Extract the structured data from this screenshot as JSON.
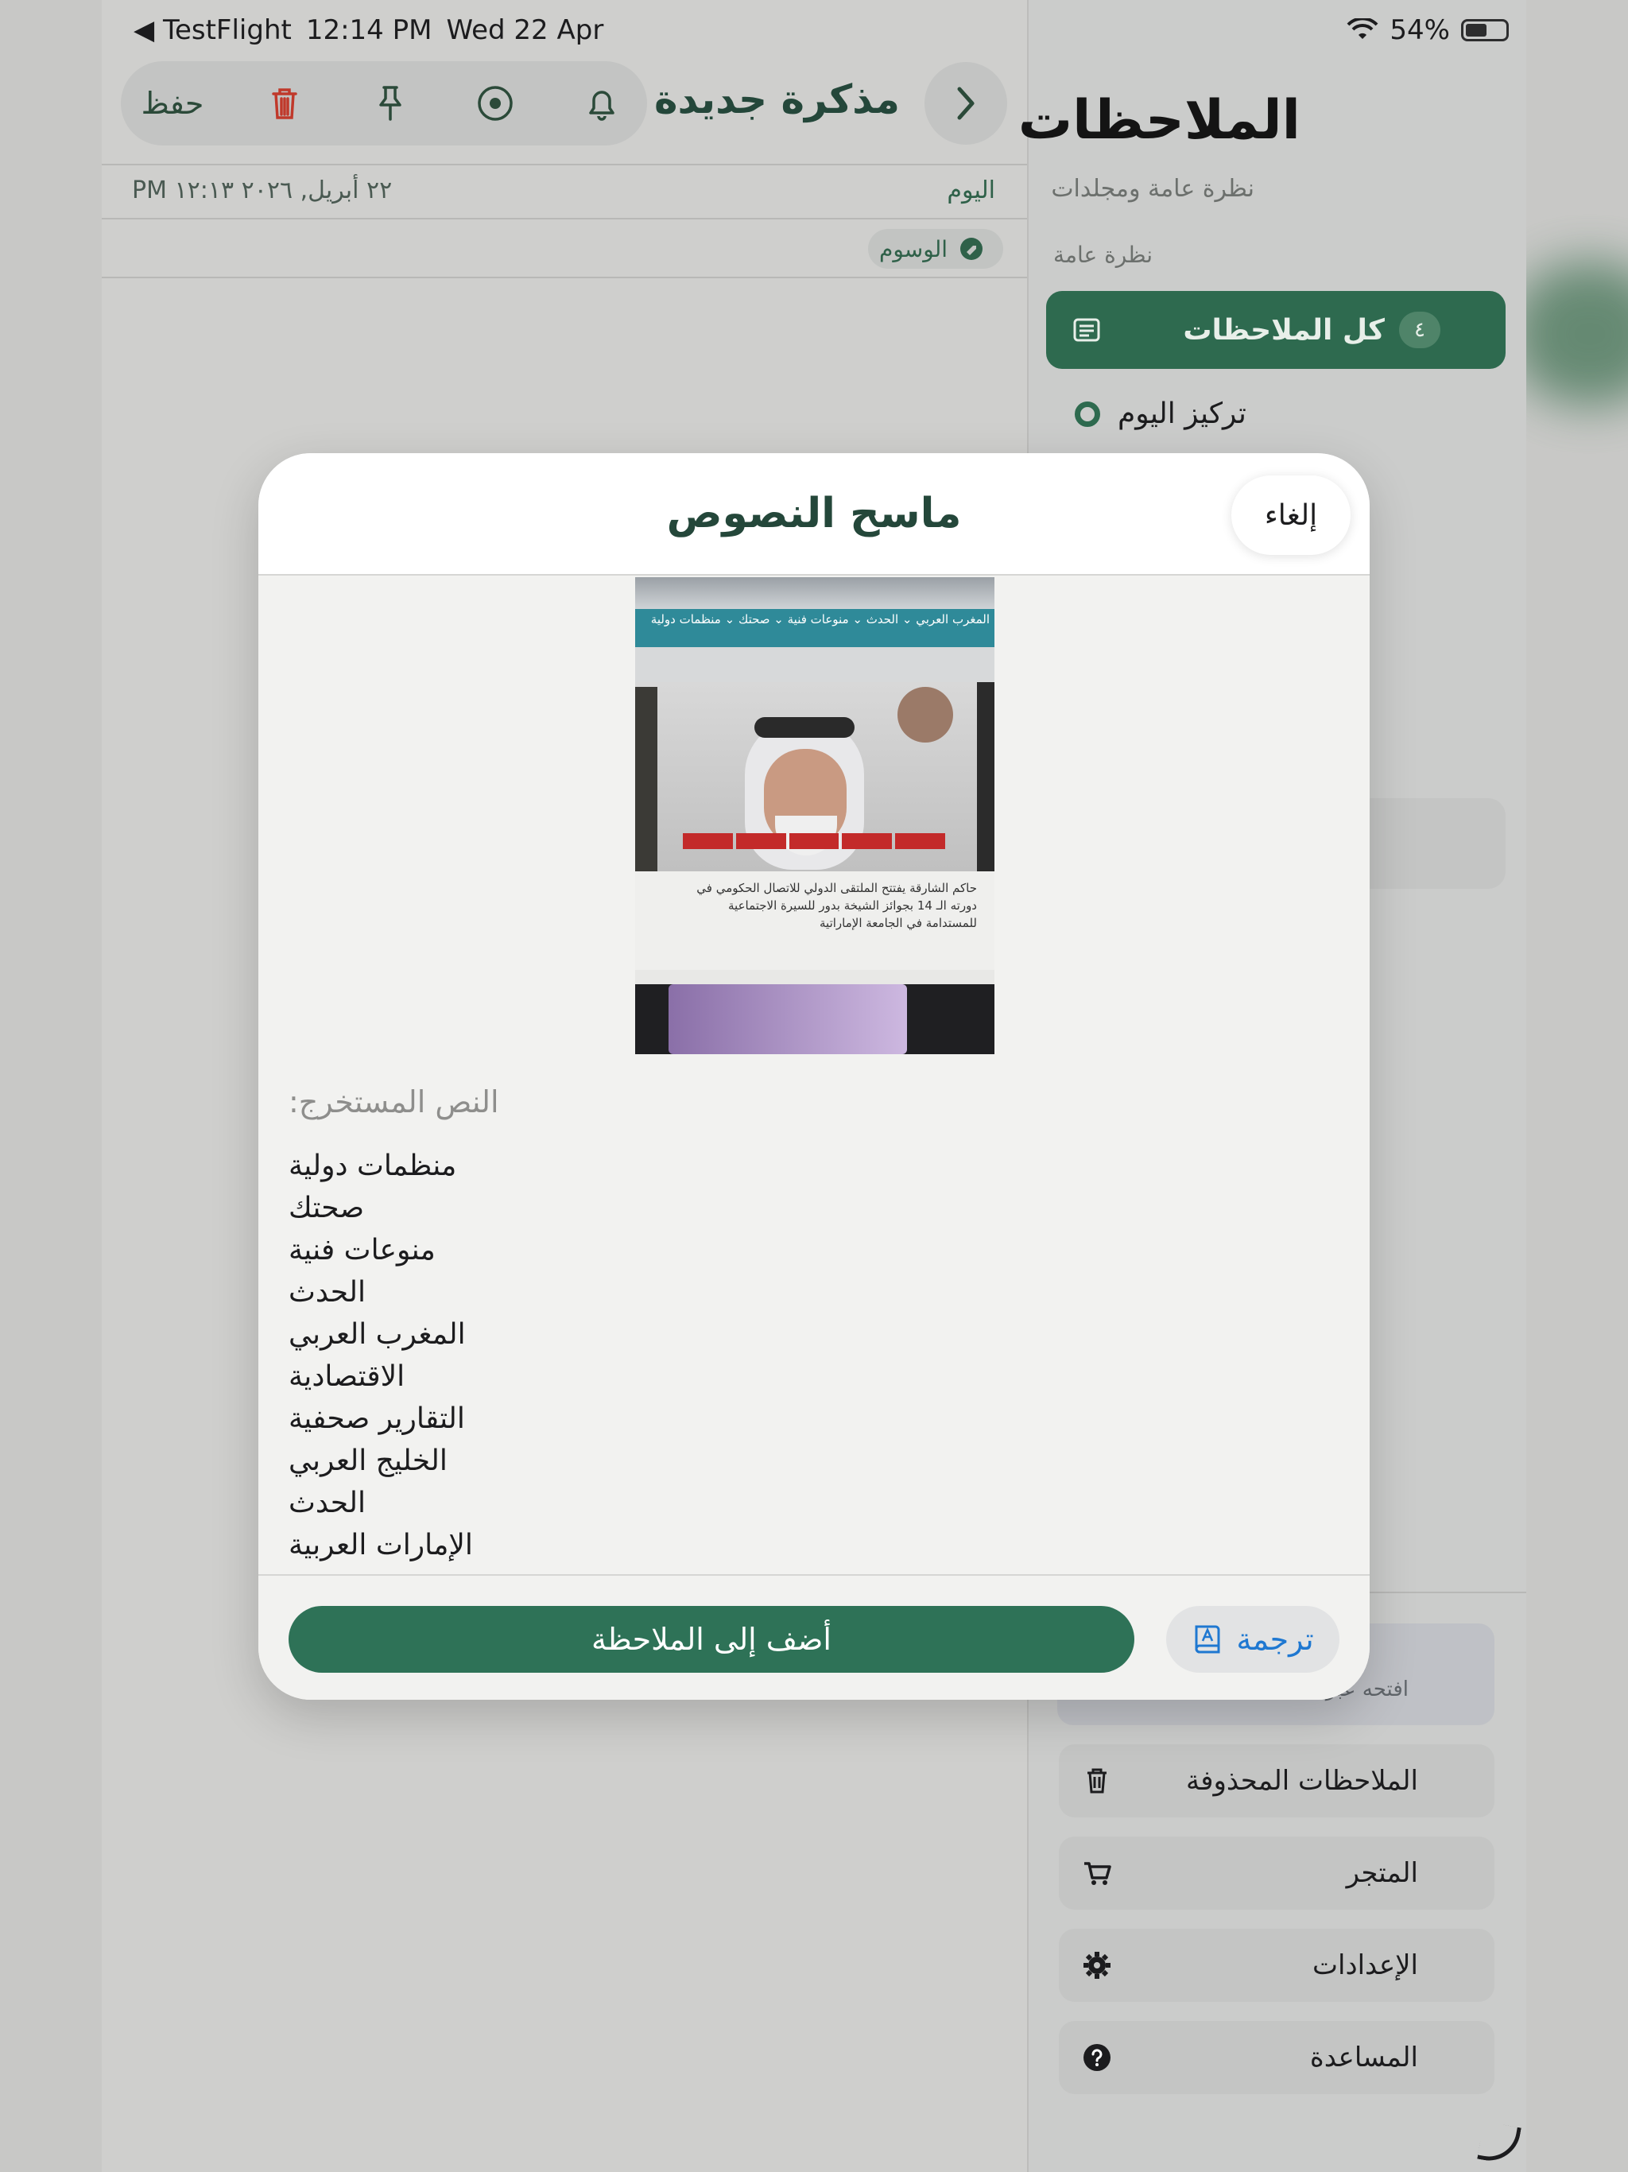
{
  "status_bar": {
    "back_label": "◀ TestFlight",
    "time": "12:14 PM",
    "date": "Wed 22 Apr",
    "battery": "54%"
  },
  "toolbar": {
    "save_label": "حفظ",
    "note_title": "مذكرة جديدة"
  },
  "note": {
    "timestamp": "٢٢ أبريل, ٢٠٢٦ ١٢:١٣ PM",
    "day_label": "اليوم",
    "tags_label": "الوسوم"
  },
  "sidebar": {
    "title": "الملاحظات",
    "subtitle": "نظرة عامة ومجلدات",
    "section_label": "نظرة عامة",
    "all_notes_label": "كل الملاحظات",
    "all_notes_count": "٤",
    "today_focus_label": "تركيز اليوم",
    "banner_text": "افتحه عبر ...",
    "buttons": [
      {
        "label": "الملاحظات المحذوفة",
        "icon": "trash-icon"
      },
      {
        "label": "المتجر",
        "icon": "cart-icon"
      },
      {
        "label": "الإعدادات",
        "icon": "gear-icon"
      },
      {
        "label": "المساعدة",
        "icon": "help-icon"
      }
    ]
  },
  "modal": {
    "title": "ماسح النصوص",
    "cancel_label": "إلغاء",
    "extracted_label": "النص المستخرج:",
    "lines": [
      "منظمات دولية",
      "صحتك",
      "منوعات فنية",
      "الحدث",
      "المغرب العربي",
      "الاقتصادية",
      "التقارير صحفية",
      "الخليج العربي",
      "الحدث",
      "الإمارات العربية"
    ],
    "add_button_label": "أضف إلى الملاحظة",
    "translate_label": "ترجمة"
  },
  "scanned_photo": {
    "nav_text": "المغرب العربي ⌄ الحدث ⌄ منوعات فنية ⌄ صحتك ⌄ منظمات دولية",
    "article_text": "حاكم الشارقة يفتتح الملتقى الدولي للاتصال الحكومي في دورته الـ 14 بجوائز الشيخة بدور للسيرة الاجتماعية للمستدامة في الجامعة الإماراتية"
  },
  "colors": {
    "accent_green": "#2e6a4f",
    "delete_red": "#c0392b",
    "link_blue": "#1f78d1"
  }
}
